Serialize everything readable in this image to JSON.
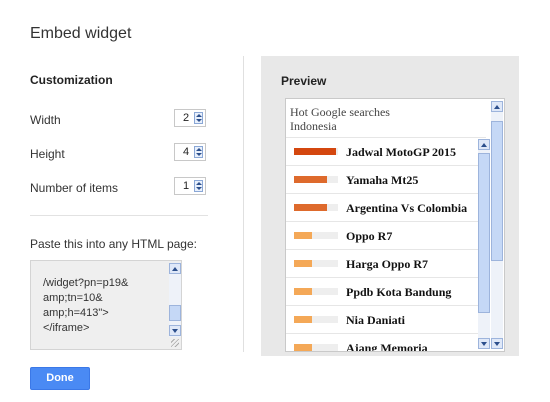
{
  "dialog": {
    "title": "Embed widget"
  },
  "customization": {
    "heading": "Customization",
    "fields": [
      {
        "label": "Width",
        "value": "2"
      },
      {
        "label": "Height",
        "value": "4"
      },
      {
        "label": "Number of items",
        "value": "1"
      }
    ]
  },
  "embed": {
    "label": "Paste this into any HTML page:",
    "code": "/widget?pn=p19&\namp;tn=10&\namp;h=413\">\n</iframe>"
  },
  "preview": {
    "heading": "Preview",
    "widget_title": "Hot Google searches",
    "widget_subtitle": "Indonesia",
    "items": [
      {
        "label": "Jadwal MotoGP 2015",
        "level": 0.95,
        "color": "#d4470f"
      },
      {
        "label": "Yamaha Mt25",
        "level": 0.75,
        "color": "#de6a2c"
      },
      {
        "label": "Argentina Vs Colombia",
        "level": 0.75,
        "color": "#de6a2c"
      },
      {
        "label": "Oppo R7",
        "level": 0.4,
        "color": "#f4a857"
      },
      {
        "label": "Harga Oppo R7",
        "level": 0.4,
        "color": "#f4a857"
      },
      {
        "label": "Ppdb Kota Bandung",
        "level": 0.4,
        "color": "#f4a857"
      },
      {
        "label": "Nia Daniati",
        "level": 0.4,
        "color": "#f4a857"
      },
      {
        "label": "Ajang Memoria",
        "level": 0.4,
        "color": "#f4a857"
      }
    ]
  },
  "footer": {
    "done_label": "Done"
  }
}
